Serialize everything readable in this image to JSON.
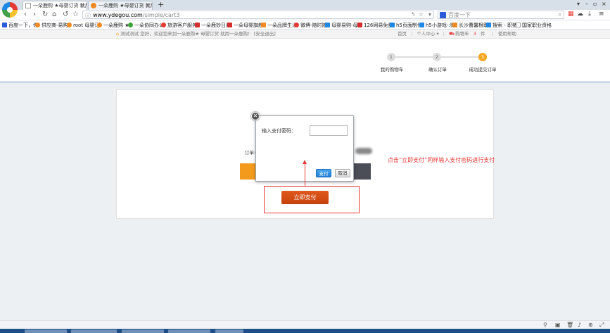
{
  "tabs": [
    {
      "label": "一朵鹿购 ★母婴订货 就用一"
    },
    {
      "label": "一朵鹿购 ★母婴订货 就用一"
    }
  ],
  "url": {
    "domain": "www.ydegou.com",
    "path": "/simple/cart3"
  },
  "search": {
    "placeholder": "百度一下"
  },
  "bookmarks": [
    {
      "label": "百度一下，你",
      "color": "#2b5bd7"
    },
    {
      "label": "供应商-易购",
      "color": "#f08a24"
    },
    {
      "label": "root 母婴订",
      "color": "#f08a24"
    },
    {
      "label": "一朵鹿购 ★",
      "color": "#f08a24"
    },
    {
      "label": "一朵协同办公",
      "color": "#3aa33a"
    },
    {
      "label": "旅游客户服务",
      "color": "#e53935"
    },
    {
      "label": "一朵鹿妙日用",
      "color": "#d32f2f"
    },
    {
      "label": "一朵母婴旗舰",
      "color": "#d32f2f"
    },
    {
      "label": "一朵品牌生活",
      "color": "#f08a24"
    },
    {
      "label": "微博-随时随",
      "color": "#e53935"
    },
    {
      "label": "母婴易购-母",
      "color": "#1e88e5"
    },
    {
      "label": "126网易免费",
      "color": "#d32f2f"
    },
    {
      "label": "h5页面制作",
      "color": "#1e88e5"
    },
    {
      "label": "h5小游戏-:微",
      "color": "#1e88e5"
    },
    {
      "label": "长沙曹馨根职",
      "color": "#f08a24"
    },
    {
      "label": "搜索 - 职猪",
      "color": "#1e88e5"
    },
    {
      "label": "国家职业资格",
      "color": "#888888"
    }
  ],
  "site_bar": {
    "welcome": "测试测试 您好，欢迎您来到一朵鹿购★ 母婴订货 就用一朵鹿购！ [安全退出]",
    "links": [
      "首页",
      "个人中心 ▾",
      "购物车",
      "3",
      "件",
      "使用帮助"
    ]
  },
  "steps": [
    {
      "num": "1",
      "label": "我的购物车"
    },
    {
      "num": "2",
      "label": "确认订单"
    },
    {
      "num": "3",
      "label": "成功提交订单"
    }
  ],
  "order_label": "订单:",
  "dialog": {
    "close_label": "✕",
    "password_label": "输入支付密码：",
    "password_value": "",
    "pay_label": "支付",
    "cancel_label": "取消"
  },
  "pay_now_label": "立即支付",
  "annotation": "点击“立即支付”同样输入支付密码进行支付",
  "colors": {
    "accent": "#f5a623",
    "annotation": "#e53935",
    "pay_button": "#c6400b"
  }
}
